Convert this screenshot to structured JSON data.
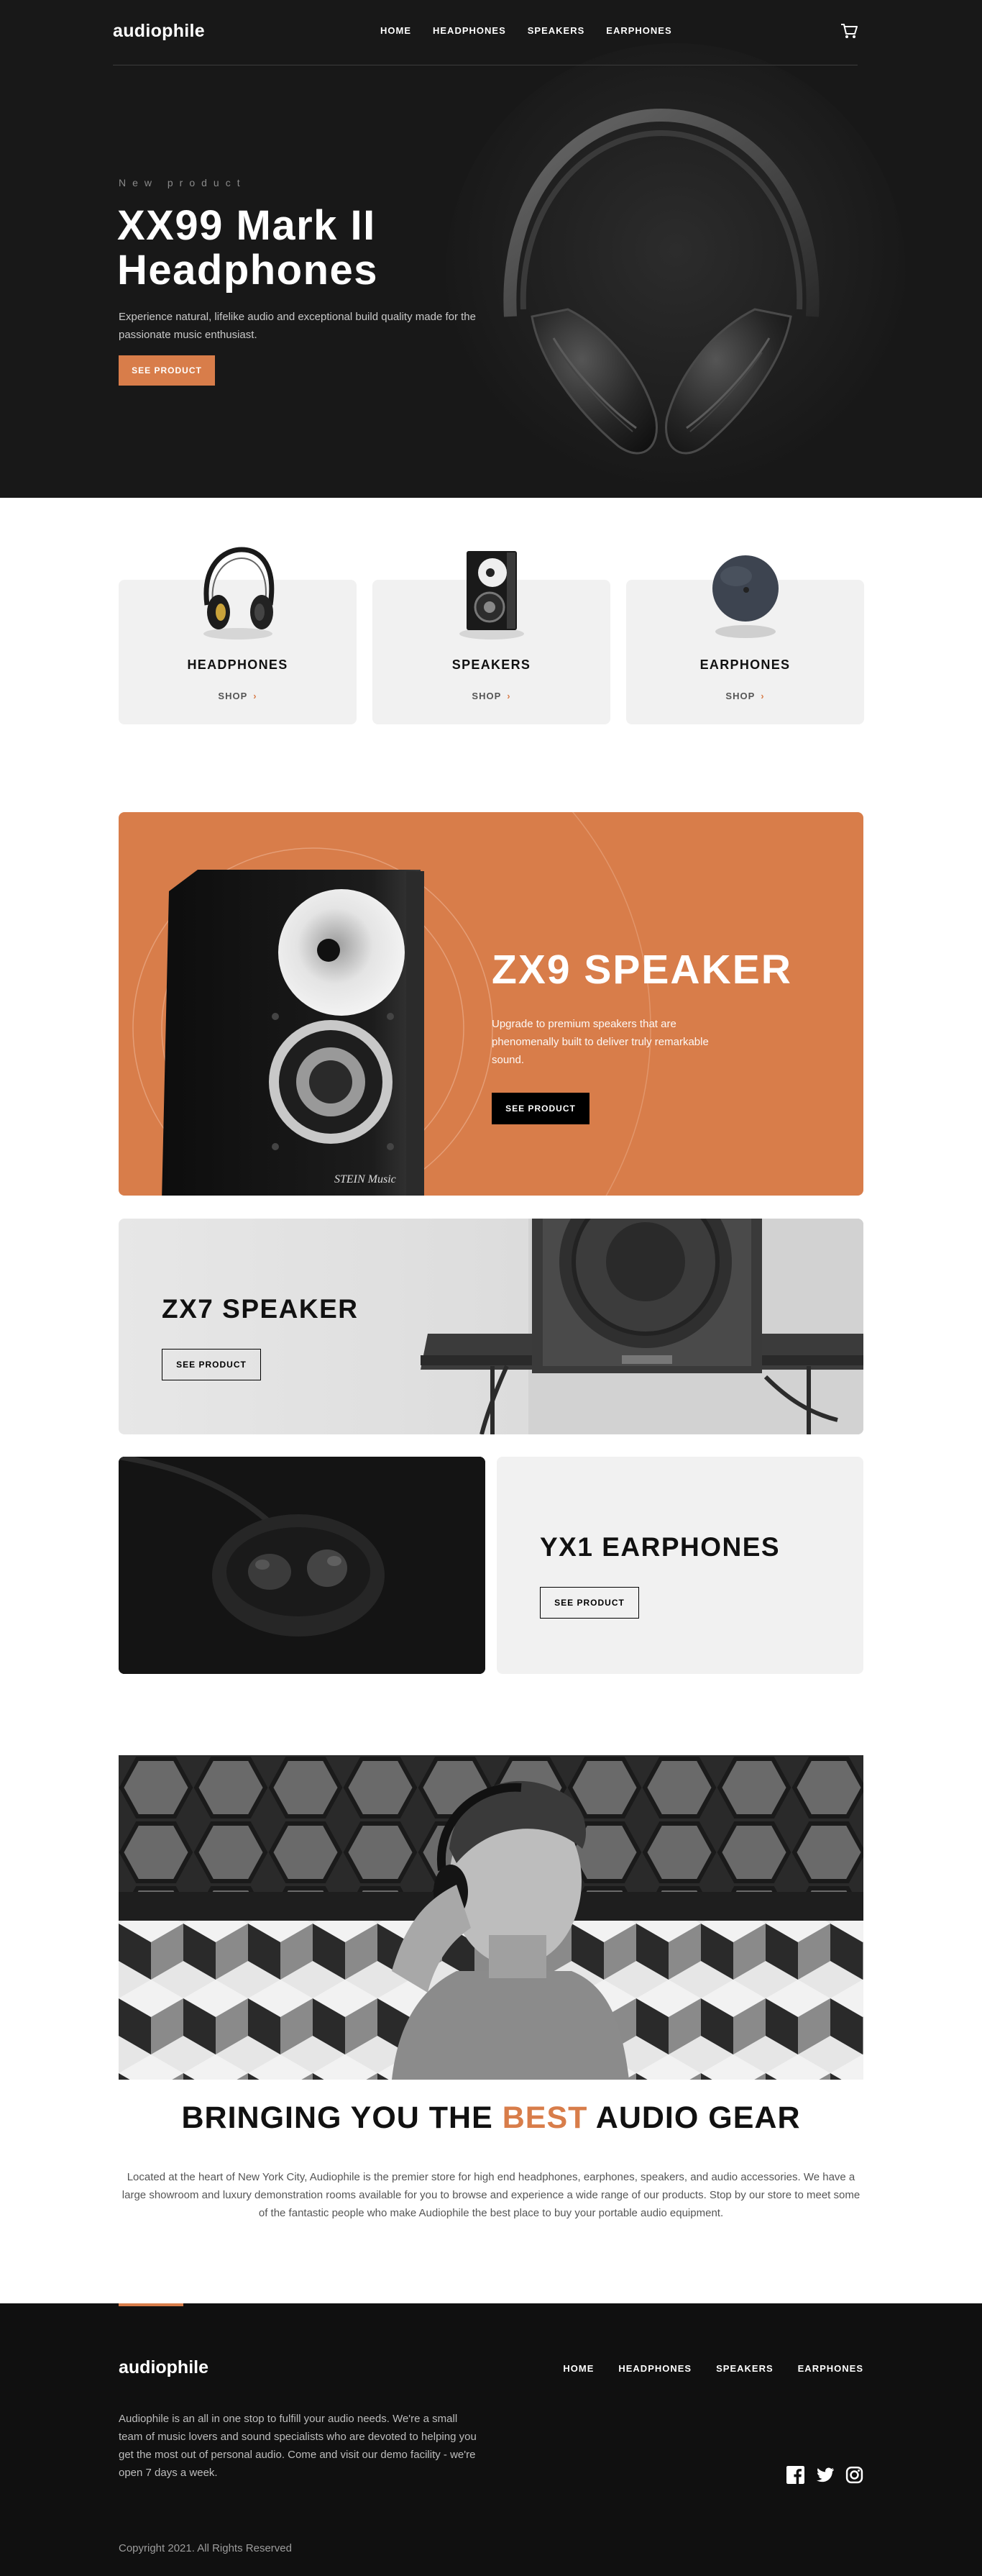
{
  "nav": {
    "logo": "audiophile",
    "links": [
      "HOME",
      "HEADPHONES",
      "SPEAKERS",
      "EARPHONES"
    ],
    "cart_icon": "cart-icon"
  },
  "hero": {
    "overline": "New product",
    "title": "XX99 Mark II Headphones",
    "description": "Experience natural, lifelike audio and exceptional build quality made for the passionate music enthusiast.",
    "cta": "SEE PRODUCT"
  },
  "categories": [
    {
      "title": "HEADPHONES",
      "shop": "SHOP"
    },
    {
      "title": "SPEAKERS",
      "shop": "SHOP"
    },
    {
      "title": "EARPHONES",
      "shop": "SHOP"
    }
  ],
  "zx9": {
    "title": "ZX9 SPEAKER",
    "description": "Upgrade to premium speakers that are phenomenally built to deliver truly remarkable sound.",
    "cta": "SEE PRODUCT",
    "speaker_brand": "STEIN Music"
  },
  "zx7": {
    "title": "ZX7 SPEAKER",
    "cta": "SEE PRODUCT"
  },
  "yx1": {
    "title": "YX1 EARPHONES",
    "cta": "SEE PRODUCT"
  },
  "about": {
    "title_prefix": "BRINGING YOU THE ",
    "title_accent": "BEST",
    "title_suffix": " AUDIO GEAR",
    "text": "Located at the heart of New York City, Audiophile is the premier store for high end headphones, earphones, speakers, and audio accessories. We have a large showroom and luxury demonstration rooms available for you to browse and experience a wide range of our products. Stop by our store to meet some of the fantastic people who make Audiophile the best place to buy your portable audio equipment."
  },
  "footer": {
    "logo": "audiophile",
    "links": [
      "HOME",
      "HEADPHONES",
      "SPEAKERS",
      "EARPHONES"
    ],
    "description": "Audiophile is an all in one stop to fulfill your audio needs. We're a small team of music lovers and sound specialists who are devoted to helping you get the most out of personal audio. Come and visit our demo facility - we're open 7 days a week.",
    "copyright": "Copyright 2021. All Rights Reserved",
    "socials": [
      "facebook-icon",
      "twitter-icon",
      "instagram-icon"
    ]
  },
  "colors": {
    "accent": "#d87d4a",
    "dark": "#101010",
    "light_card": "#f1f1f1"
  }
}
